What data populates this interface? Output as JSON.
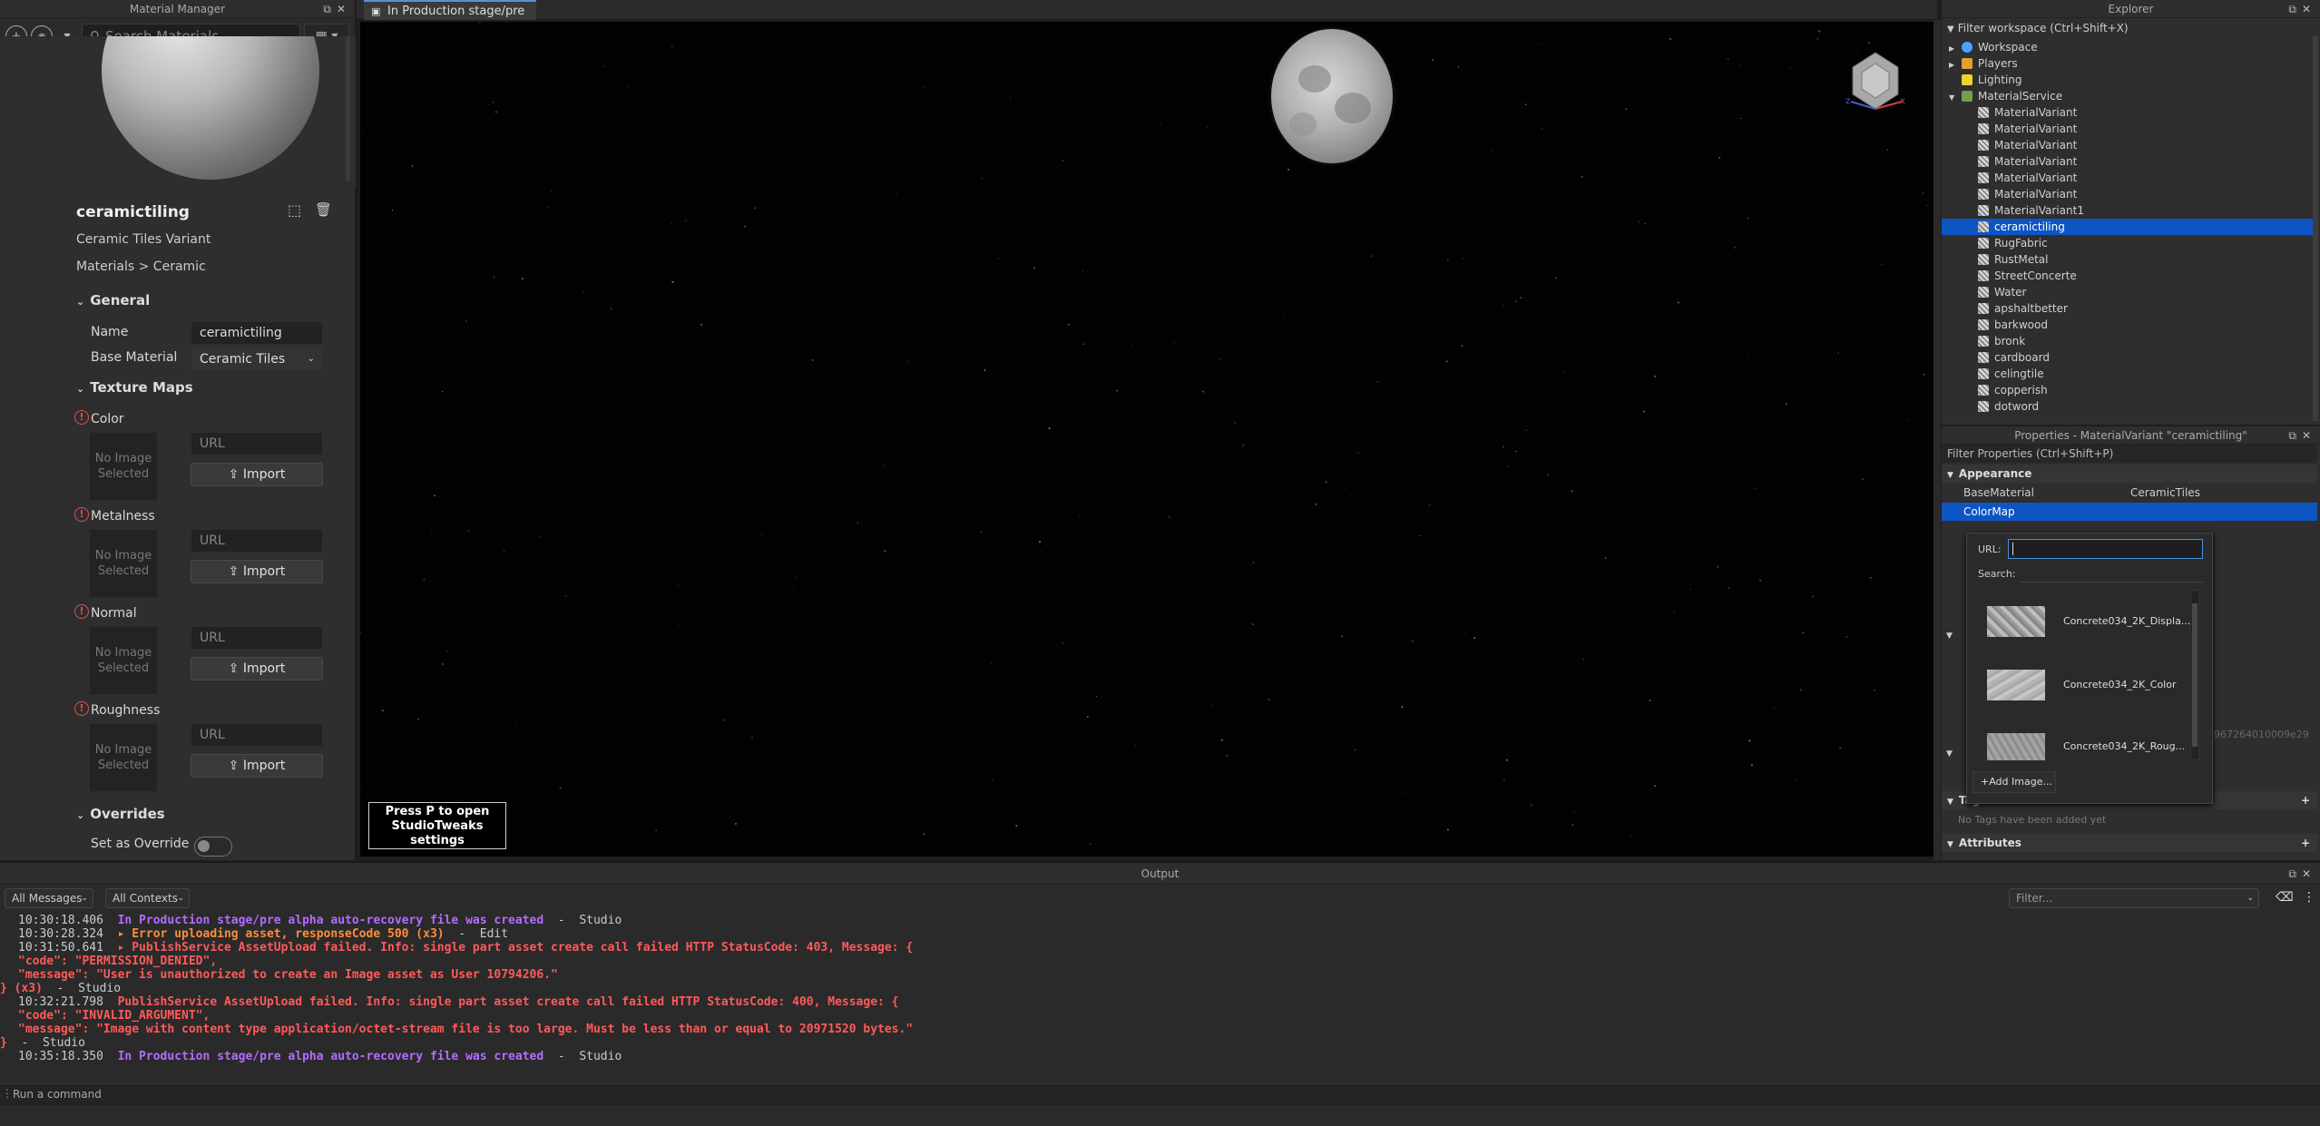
{
  "material_manager": {
    "title": "Material Manager",
    "search_placeholder": "Search Materials",
    "material_name": "ceramictiling",
    "variant_label": "Ceramic Tiles Variant",
    "breadcrumb": "Materials > Ceramic",
    "general": {
      "label": "General",
      "name_label": "Name",
      "name_value": "ceramictiling",
      "base_material_label": "Base Material",
      "base_material_value": "Ceramic Tiles"
    },
    "texture_maps": {
      "label": "Texture Maps",
      "maps": [
        {
          "label": "Color",
          "no_image": "No Image Selected",
          "url_placeholder": "URL",
          "import_label": "Import"
        },
        {
          "label": "Metalness",
          "no_image": "No Image Selected",
          "url_placeholder": "URL",
          "import_label": "Import"
        },
        {
          "label": "Normal",
          "no_image": "No Image Selected",
          "url_placeholder": "URL",
          "import_label": "Import"
        },
        {
          "label": "Roughness",
          "no_image": "No Image Selected",
          "url_placeholder": "URL",
          "import_label": "Import"
        }
      ]
    },
    "overrides": {
      "label": "Overrides",
      "set_as_override_label": "Set as Override"
    }
  },
  "tabs": [
    {
      "label": "In Production stage/pre alpha"
    }
  ],
  "viewport": {
    "studio_tweaks": "Press P to open StudioTweaks settings"
  },
  "explorer": {
    "title": "Explorer",
    "filter_placeholder": "Filter workspace (Ctrl+Shift+X)",
    "items": [
      {
        "label": "Workspace"
      },
      {
        "label": "Players"
      },
      {
        "label": "Lighting"
      },
      {
        "label": "MaterialService"
      },
      {
        "label": "MaterialVariant"
      },
      {
        "label": "MaterialVariant"
      },
      {
        "label": "MaterialVariant"
      },
      {
        "label": "MaterialVariant"
      },
      {
        "label": "MaterialVariant"
      },
      {
        "label": "MaterialVariant"
      },
      {
        "label": "MaterialVariant1"
      },
      {
        "label": "ceramictiling"
      },
      {
        "label": "RugFabric"
      },
      {
        "label": "RustMetal"
      },
      {
        "label": "StreetConcerte"
      },
      {
        "label": "Water"
      },
      {
        "label": "apshaltbetter"
      },
      {
        "label": "barkwood"
      },
      {
        "label": "bronk"
      },
      {
        "label": "cardboard"
      },
      {
        "label": "celingtile"
      },
      {
        "label": "copperish"
      },
      {
        "label": "dotword"
      }
    ]
  },
  "properties": {
    "title": "Properties - MaterialVariant \"ceramictiling\"",
    "filter_placeholder": "Filter Properties (Ctrl+Shift+P)",
    "appearance_label": "Appearance",
    "base_material_label": "BaseMaterial",
    "base_material_value": "CeramicTiles",
    "color_map_label": "ColorMap",
    "partial_value": "967264010009e29",
    "tags_label": "Tags",
    "tags_empty": "No Tags have been added yet",
    "attributes_label": "Attributes"
  },
  "asset_picker": {
    "url_label": "URL:",
    "search_label": "Search:",
    "items": [
      {
        "label": "Concrete034_2K_Displa..."
      },
      {
        "label": "Concrete034_2K_Color"
      },
      {
        "label": "Concrete034_2K_Roug..."
      }
    ],
    "add_image_label": "Add Image..."
  },
  "output": {
    "title": "Output",
    "messages_filter": "All Messages",
    "contexts_filter": "All Contexts",
    "filter_placeholder": "Filter...",
    "lines": [
      {
        "time": "10:30:18.406",
        "text": "In Production stage/pre alpha auto-recovery file was created",
        "suffix": "  -  Studio",
        "color": "#b56bff"
      },
      {
        "time": "10:30:28.324",
        "text": "▸ Error uploading asset, responseCode 500 (x3)",
        "suffix": "  -  Edit",
        "color": "#ff8c3a"
      },
      {
        "time": "10:31:50.641",
        "text": "▸ PublishService AssetUpload failed. Info: single part asset create call failed HTTP StatusCode: 403, Message: {",
        "suffix": "",
        "color": "#ff5a5a"
      },
      {
        "time": "",
        "text": "\"code\": \"PERMISSION_DENIED\",",
        "suffix": "",
        "color": "#ff5a5a"
      },
      {
        "time": "",
        "text": "\"message\": \"User is unauthorized to create an Image asset as User 10794206.\"",
        "suffix": "",
        "color": "#ff5a5a"
      },
      {
        "time": "",
        "text": "} (x3)",
        "suffix": "  -  Studio",
        "color": "#ff5a5a"
      },
      {
        "time": "10:32:21.798",
        "text": "PublishService AssetUpload failed. Info: single part asset create call failed HTTP StatusCode: 400, Message: {",
        "suffix": "",
        "color": "#ff5a5a"
      },
      {
        "time": "",
        "text": "\"code\": \"INVALID_ARGUMENT\",",
        "suffix": "",
        "color": "#ff5a5a"
      },
      {
        "time": "",
        "text": "\"message\": \"Image with content type application/octet-stream file is too large. Must be less than or equal to 20971520 bytes.\"",
        "suffix": "",
        "color": "#ff5a5a"
      },
      {
        "time": "",
        "text": "}",
        "suffix": "  -  Studio",
        "color": "#ff5a5a"
      },
      {
        "time": "10:35:18.350",
        "text": "In Production stage/pre alpha auto-recovery file was created",
        "suffix": "  -  Studio",
        "color": "#b56bff"
      }
    ],
    "command_placeholder": "Run a command"
  }
}
